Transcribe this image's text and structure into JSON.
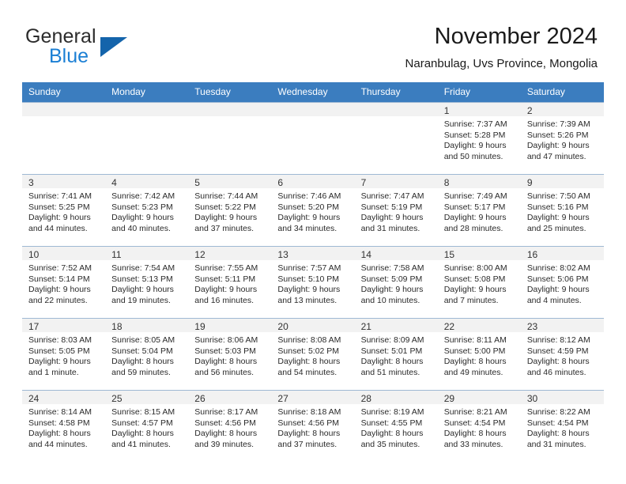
{
  "brand": {
    "word1": "General",
    "word2": "Blue",
    "triangle_color": "#1464ab",
    "blue_color": "#1b7fd4"
  },
  "header": {
    "title": "November 2024",
    "subtitle": "Naranbulag, Uvs Province, Mongolia"
  },
  "theme": {
    "header_bg": "#3b7dbf",
    "header_text": "#ffffff",
    "daynum_band_bg": "#f2f2f2",
    "grid_line": "#9fb9d4"
  },
  "weekday_headers": [
    "Sunday",
    "Monday",
    "Tuesday",
    "Wednesday",
    "Thursday",
    "Friday",
    "Saturday"
  ],
  "weeks": [
    [
      {
        "day": "",
        "lines": []
      },
      {
        "day": "",
        "lines": []
      },
      {
        "day": "",
        "lines": []
      },
      {
        "day": "",
        "lines": []
      },
      {
        "day": "",
        "lines": []
      },
      {
        "day": "1",
        "lines": [
          "Sunrise: 7:37 AM",
          "Sunset: 5:28 PM",
          "Daylight: 9 hours",
          "and 50 minutes."
        ]
      },
      {
        "day": "2",
        "lines": [
          "Sunrise: 7:39 AM",
          "Sunset: 5:26 PM",
          "Daylight: 9 hours",
          "and 47 minutes."
        ]
      }
    ],
    [
      {
        "day": "3",
        "lines": [
          "Sunrise: 7:41 AM",
          "Sunset: 5:25 PM",
          "Daylight: 9 hours",
          "and 44 minutes."
        ]
      },
      {
        "day": "4",
        "lines": [
          "Sunrise: 7:42 AM",
          "Sunset: 5:23 PM",
          "Daylight: 9 hours",
          "and 40 minutes."
        ]
      },
      {
        "day": "5",
        "lines": [
          "Sunrise: 7:44 AM",
          "Sunset: 5:22 PM",
          "Daylight: 9 hours",
          "and 37 minutes."
        ]
      },
      {
        "day": "6",
        "lines": [
          "Sunrise: 7:46 AM",
          "Sunset: 5:20 PM",
          "Daylight: 9 hours",
          "and 34 minutes."
        ]
      },
      {
        "day": "7",
        "lines": [
          "Sunrise: 7:47 AM",
          "Sunset: 5:19 PM",
          "Daylight: 9 hours",
          "and 31 minutes."
        ]
      },
      {
        "day": "8",
        "lines": [
          "Sunrise: 7:49 AM",
          "Sunset: 5:17 PM",
          "Daylight: 9 hours",
          "and 28 minutes."
        ]
      },
      {
        "day": "9",
        "lines": [
          "Sunrise: 7:50 AM",
          "Sunset: 5:16 PM",
          "Daylight: 9 hours",
          "and 25 minutes."
        ]
      }
    ],
    [
      {
        "day": "10",
        "lines": [
          "Sunrise: 7:52 AM",
          "Sunset: 5:14 PM",
          "Daylight: 9 hours",
          "and 22 minutes."
        ]
      },
      {
        "day": "11",
        "lines": [
          "Sunrise: 7:54 AM",
          "Sunset: 5:13 PM",
          "Daylight: 9 hours",
          "and 19 minutes."
        ]
      },
      {
        "day": "12",
        "lines": [
          "Sunrise: 7:55 AM",
          "Sunset: 5:11 PM",
          "Daylight: 9 hours",
          "and 16 minutes."
        ]
      },
      {
        "day": "13",
        "lines": [
          "Sunrise: 7:57 AM",
          "Sunset: 5:10 PM",
          "Daylight: 9 hours",
          "and 13 minutes."
        ]
      },
      {
        "day": "14",
        "lines": [
          "Sunrise: 7:58 AM",
          "Sunset: 5:09 PM",
          "Daylight: 9 hours",
          "and 10 minutes."
        ]
      },
      {
        "day": "15",
        "lines": [
          "Sunrise: 8:00 AM",
          "Sunset: 5:08 PM",
          "Daylight: 9 hours",
          "and 7 minutes."
        ]
      },
      {
        "day": "16",
        "lines": [
          "Sunrise: 8:02 AM",
          "Sunset: 5:06 PM",
          "Daylight: 9 hours",
          "and 4 minutes."
        ]
      }
    ],
    [
      {
        "day": "17",
        "lines": [
          "Sunrise: 8:03 AM",
          "Sunset: 5:05 PM",
          "Daylight: 9 hours",
          "and 1 minute."
        ]
      },
      {
        "day": "18",
        "lines": [
          "Sunrise: 8:05 AM",
          "Sunset: 5:04 PM",
          "Daylight: 8 hours",
          "and 59 minutes."
        ]
      },
      {
        "day": "19",
        "lines": [
          "Sunrise: 8:06 AM",
          "Sunset: 5:03 PM",
          "Daylight: 8 hours",
          "and 56 minutes."
        ]
      },
      {
        "day": "20",
        "lines": [
          "Sunrise: 8:08 AM",
          "Sunset: 5:02 PM",
          "Daylight: 8 hours",
          "and 54 minutes."
        ]
      },
      {
        "day": "21",
        "lines": [
          "Sunrise: 8:09 AM",
          "Sunset: 5:01 PM",
          "Daylight: 8 hours",
          "and 51 minutes."
        ]
      },
      {
        "day": "22",
        "lines": [
          "Sunrise: 8:11 AM",
          "Sunset: 5:00 PM",
          "Daylight: 8 hours",
          "and 49 minutes."
        ]
      },
      {
        "day": "23",
        "lines": [
          "Sunrise: 8:12 AM",
          "Sunset: 4:59 PM",
          "Daylight: 8 hours",
          "and 46 minutes."
        ]
      }
    ],
    [
      {
        "day": "24",
        "lines": [
          "Sunrise: 8:14 AM",
          "Sunset: 4:58 PM",
          "Daylight: 8 hours",
          "and 44 minutes."
        ]
      },
      {
        "day": "25",
        "lines": [
          "Sunrise: 8:15 AM",
          "Sunset: 4:57 PM",
          "Daylight: 8 hours",
          "and 41 minutes."
        ]
      },
      {
        "day": "26",
        "lines": [
          "Sunrise: 8:17 AM",
          "Sunset: 4:56 PM",
          "Daylight: 8 hours",
          "and 39 minutes."
        ]
      },
      {
        "day": "27",
        "lines": [
          "Sunrise: 8:18 AM",
          "Sunset: 4:56 PM",
          "Daylight: 8 hours",
          "and 37 minutes."
        ]
      },
      {
        "day": "28",
        "lines": [
          "Sunrise: 8:19 AM",
          "Sunset: 4:55 PM",
          "Daylight: 8 hours",
          "and 35 minutes."
        ]
      },
      {
        "day": "29",
        "lines": [
          "Sunrise: 8:21 AM",
          "Sunset: 4:54 PM",
          "Daylight: 8 hours",
          "and 33 minutes."
        ]
      },
      {
        "day": "30",
        "lines": [
          "Sunrise: 8:22 AM",
          "Sunset: 4:54 PM",
          "Daylight: 8 hours",
          "and 31 minutes."
        ]
      }
    ]
  ]
}
